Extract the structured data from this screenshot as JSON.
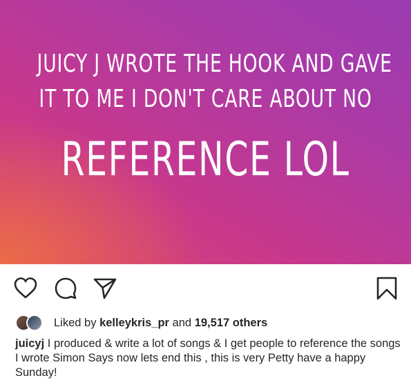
{
  "post_image": {
    "line1": "JUICY J WROTE THE HOOK AND GAVE",
    "line2": "IT TO ME I DON'T CARE ABOUT NO",
    "line3": "REFERENCE LOL",
    "colors": {
      "pink": "#d9456f",
      "purple": "#9b3bb2",
      "orange": "#ec6e46"
    }
  },
  "actions": {
    "icons": [
      "heart-icon",
      "comment-icon",
      "share-icon",
      "bookmark-icon"
    ]
  },
  "likes": {
    "prefix": "Liked by",
    "user": "kelleykris_pr",
    "connector": "and",
    "count": "19,517 others"
  },
  "caption": {
    "username": "juicyj",
    "text": "I produced & write a lot of songs & I get people to reference the songs I wrote Simon Says  now lets end this , this is very Petty have a happy Sunday!"
  }
}
